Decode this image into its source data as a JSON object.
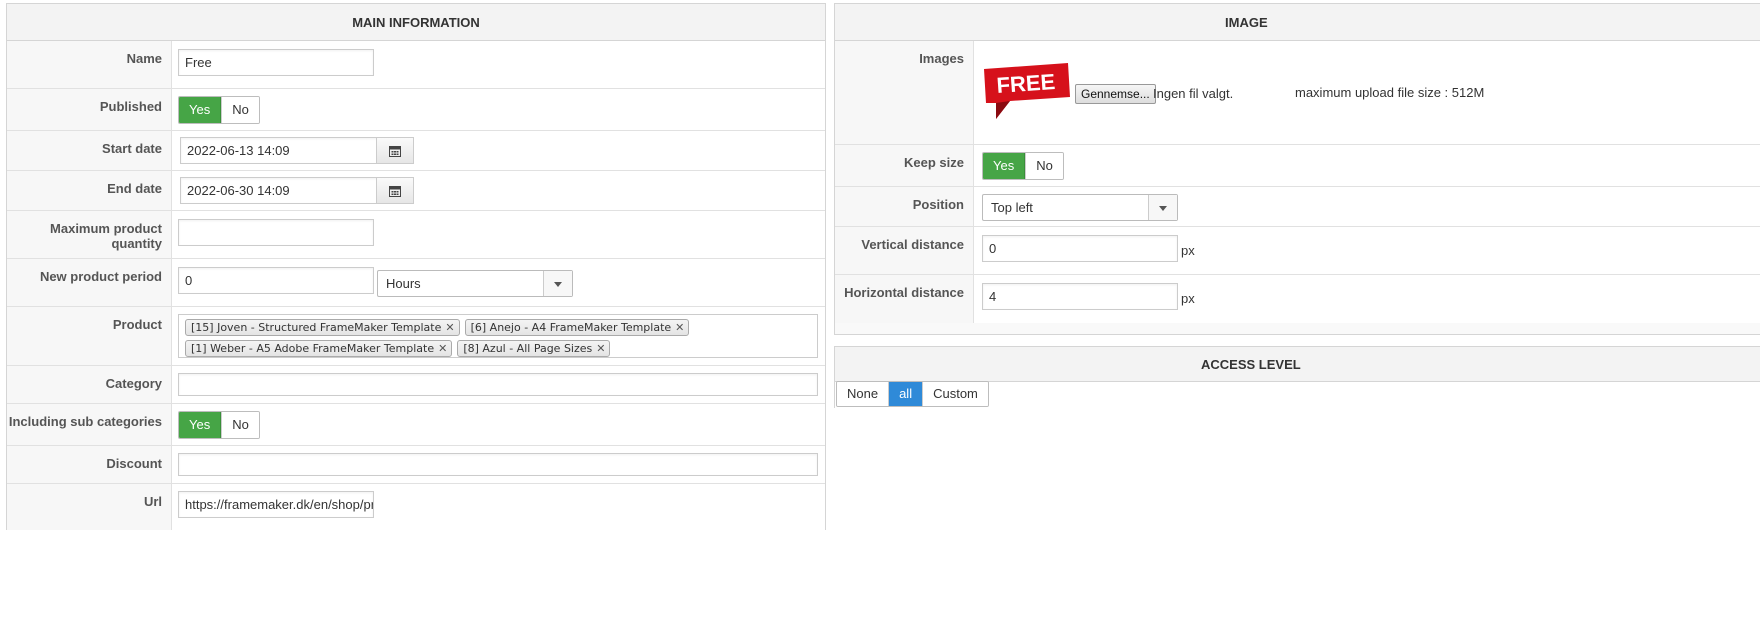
{
  "main_panel": {
    "title": "MAIN INFORMATION",
    "name": {
      "label": "Name",
      "value": "Free"
    },
    "published": {
      "label": "Published",
      "yes": "Yes",
      "no": "No",
      "selected": "Yes"
    },
    "start_date": {
      "label": "Start date",
      "value": "2022-06-13 14:09"
    },
    "end_date": {
      "label": "End date",
      "value": "2022-06-30 14:09"
    },
    "max_qty": {
      "label": "Maximum product quantity",
      "value": ""
    },
    "new_period": {
      "label": "New product period",
      "value": "0",
      "unit": "Hours"
    },
    "product": {
      "label": "Product",
      "items": [
        "[15] Joven - Structured FrameMaker Template",
        "[6] Anejo - A4 FrameMaker Template",
        "[1] Weber - A5 Adobe FrameMaker Template",
        "[8] Azul - All Page Sizes"
      ]
    },
    "category": {
      "label": "Category",
      "value": ""
    },
    "sub_categories": {
      "label": "Including sub categories",
      "yes": "Yes",
      "no": "No",
      "selected": "Yes"
    },
    "discount": {
      "label": "Discount",
      "value": ""
    },
    "url": {
      "label": "Url",
      "value": "https://framemaker.dk/en/shop/proc"
    }
  },
  "image_panel": {
    "title": "IMAGE",
    "images": {
      "label": "Images",
      "badge_text": "FREE",
      "browse_label": "Gennemse...",
      "no_file": "Ingen fil valgt.",
      "max_upload": "maximum upload file size : 512M"
    },
    "keep_size": {
      "label": "Keep size",
      "yes": "Yes",
      "no": "No",
      "selected": "Yes"
    },
    "position": {
      "label": "Position",
      "value": "Top left"
    },
    "vertical": {
      "label": "Vertical distance",
      "value": "0",
      "unit": "px"
    },
    "horizontal": {
      "label": "Horizontal distance",
      "value": "4",
      "unit": "px"
    }
  },
  "access_panel": {
    "title": "ACCESS LEVEL",
    "options": [
      "None",
      "all",
      "Custom"
    ],
    "selected": "all"
  },
  "colors": {
    "toggle_on": "#46a546",
    "selected_blue": "#2f8ad8",
    "badge_red": "#d6111b"
  }
}
